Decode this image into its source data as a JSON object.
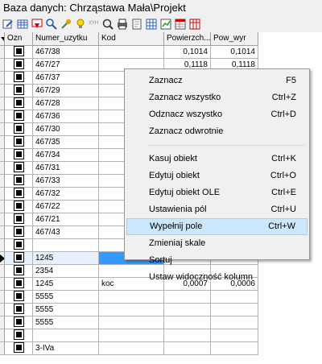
{
  "title": "Baza danych: Chrząstawa Mała\\Projekt",
  "toolbar": {
    "icons": [
      "edit-icon",
      "table-icon",
      "filter-icon",
      "search-icon",
      "tool-icon",
      "bulb-icon",
      "xyh-icon",
      "zoom-icon",
      "print-icon",
      "page-icon",
      "grid-icon",
      "chart-icon",
      "sheet-icon",
      "column-icon"
    ],
    "xyh_label": "XYH"
  },
  "grid": {
    "columns": [
      "Ozn",
      "Numer_uzytku",
      "Kod",
      "Powierzch...",
      "Pow_wyr"
    ],
    "rows": [
      {
        "num": "467/38",
        "kod": "",
        "pow": "0,1014",
        "pwr": "0,1014"
      },
      {
        "num": "467/27",
        "kod": "",
        "pow": "0,1118",
        "pwr": "0,1118"
      },
      {
        "num": "467/37",
        "kod": "",
        "pow": "",
        "pwr": ""
      },
      {
        "num": "467/29",
        "kod": "",
        "pow": "",
        "pwr": ""
      },
      {
        "num": "467/28",
        "kod": "",
        "pow": "",
        "pwr": ""
      },
      {
        "num": "467/36",
        "kod": "",
        "pow": "",
        "pwr": ""
      },
      {
        "num": "467/30",
        "kod": "",
        "pow": "",
        "pwr": ""
      },
      {
        "num": "467/35",
        "kod": "",
        "pow": "",
        "pwr": ""
      },
      {
        "num": "467/34",
        "kod": "",
        "pow": "",
        "pwr": ""
      },
      {
        "num": "467/31",
        "kod": "",
        "pow": "",
        "pwr": ""
      },
      {
        "num": "467/33",
        "kod": "",
        "pow": "",
        "pwr": ""
      },
      {
        "num": "467/32",
        "kod": "",
        "pow": "",
        "pwr": ""
      },
      {
        "num": "467/22",
        "kod": "",
        "pow": "",
        "pwr": ""
      },
      {
        "num": "467/21",
        "kod": "",
        "pow": "",
        "pwr": ""
      },
      {
        "num": "467/43",
        "kod": "",
        "pow": "",
        "pwr": ""
      },
      {
        "num": "",
        "kod": "",
        "pow": "",
        "pwr": ""
      },
      {
        "num": "1245",
        "kod": "",
        "pow": "",
        "pwr": "",
        "current": true
      },
      {
        "num": "2354",
        "kod": "",
        "pow": "",
        "pwr": ""
      },
      {
        "num": "1245",
        "kod": "koc",
        "pow": "0,0007",
        "pwr": "0,0006"
      },
      {
        "num": "5555",
        "kod": "",
        "pow": "",
        "pwr": ""
      },
      {
        "num": "5555",
        "kod": "",
        "pow": "",
        "pwr": ""
      },
      {
        "num": "5555",
        "kod": "",
        "pow": "",
        "pwr": ""
      },
      {
        "num": "",
        "kod": "",
        "pow": "",
        "pwr": ""
      },
      {
        "num": "3-IVa",
        "kod": "",
        "pow": "",
        "pwr": ""
      }
    ]
  },
  "context_menu": {
    "items": [
      {
        "label": "Zaznacz",
        "shortcut": "F5"
      },
      {
        "label": "Zaznacz wszystko",
        "shortcut": "Ctrl+Z"
      },
      {
        "label": "Odznacz wszystko",
        "shortcut": "Ctrl+D"
      },
      {
        "label": "Zaznacz odwrotnie",
        "shortcut": ""
      },
      {
        "separator": true
      },
      {
        "label": "Kasuj obiekt",
        "shortcut": "Ctrl+K"
      },
      {
        "label": "Edytuj obiekt",
        "shortcut": "Ctrl+O"
      },
      {
        "label": "Edytuj obiekt OLE",
        "shortcut": "Ctrl+E"
      },
      {
        "label": "Ustawienia pól",
        "shortcut": "Ctrl+U"
      },
      {
        "label": "Wypełnij pole",
        "shortcut": "Ctrl+W",
        "highlighted": true
      },
      {
        "label": "Zmieniaj skale",
        "shortcut": ""
      },
      {
        "label": "Sortuj",
        "shortcut": ""
      },
      {
        "label": "Ustaw widoczność kolumn",
        "shortcut": ""
      }
    ]
  },
  "colors": {
    "selection": "#3399ff",
    "menu_highlight": "#cce8ff"
  }
}
